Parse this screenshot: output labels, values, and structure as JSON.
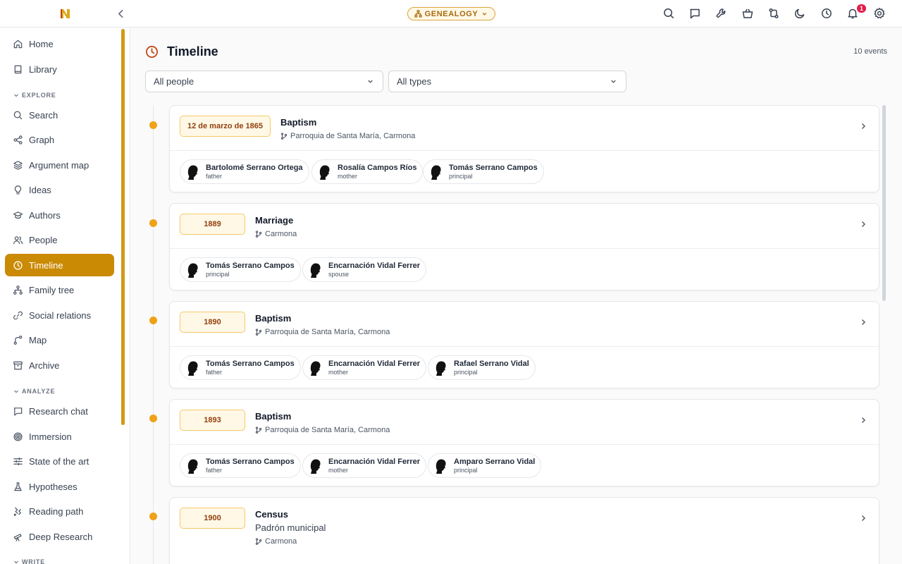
{
  "app": {
    "mode_label": "GENEALOGY",
    "notification_count": "1"
  },
  "sidebar": {
    "items_top": [
      {
        "id": "home",
        "label": "Home",
        "icon": "home-icon"
      },
      {
        "id": "library",
        "label": "Library",
        "icon": "book-icon"
      }
    ],
    "sections": [
      {
        "label": "EXPLORE",
        "items": [
          {
            "id": "search",
            "label": "Search",
            "icon": "search-icon"
          },
          {
            "id": "graph",
            "label": "Graph",
            "icon": "share-icon"
          },
          {
            "id": "argument-map",
            "label": "Argument map",
            "icon": "layers-icon"
          },
          {
            "id": "ideas",
            "label": "Ideas",
            "icon": "lightbulb-icon"
          },
          {
            "id": "authors",
            "label": "Authors",
            "icon": "graduation-cap-icon"
          },
          {
            "id": "people",
            "label": "People",
            "icon": "users-icon"
          },
          {
            "id": "timeline",
            "label": "Timeline",
            "icon": "clock-icon",
            "active": true
          },
          {
            "id": "family-tree",
            "label": "Family tree",
            "icon": "family-tree-icon"
          },
          {
            "id": "social-relations",
            "label": "Social relations",
            "icon": "link-icon"
          },
          {
            "id": "map",
            "label": "Map",
            "icon": "map-route-icon"
          },
          {
            "id": "archive",
            "label": "Archive",
            "icon": "archive-icon"
          }
        ]
      },
      {
        "label": "ANALYZE",
        "items": [
          {
            "id": "research-chat",
            "label": "Research chat",
            "icon": "chat-icon"
          },
          {
            "id": "immersion",
            "label": "Immersion",
            "icon": "target-icon"
          },
          {
            "id": "state-of-the-art",
            "label": "State of the art",
            "icon": "sliders-icon"
          },
          {
            "id": "hypotheses",
            "label": "Hypotheses",
            "icon": "flask-icon"
          },
          {
            "id": "reading-path",
            "label": "Reading path",
            "icon": "footprints-icon"
          },
          {
            "id": "deep-research",
            "label": "Deep Research",
            "icon": "telescope-icon"
          }
        ]
      },
      {
        "label": "WRITE",
        "items": []
      }
    ]
  },
  "main": {
    "title": "Timeline",
    "event_count": "10 events",
    "filters": {
      "people": "All people",
      "types": "All types"
    },
    "events": [
      {
        "date": "12 de marzo de 1865",
        "type": "Baptism",
        "subtitle": "",
        "place": "Parroquia de Santa María, Carmona",
        "people": [
          {
            "name": "Bartolomé Serrano Ortega",
            "role": "father"
          },
          {
            "name": "Rosalía Campos Ríos",
            "role": "mother"
          },
          {
            "name": "Tomás Serrano Campos",
            "role": "principal"
          }
        ]
      },
      {
        "date": "1889",
        "type": "Marriage",
        "subtitle": "",
        "place": "Carmona",
        "people": [
          {
            "name": "Tomás Serrano Campos",
            "role": "principal"
          },
          {
            "name": "Encarnación Vidal Ferrer",
            "role": "spouse"
          }
        ]
      },
      {
        "date": "1890",
        "type": "Baptism",
        "subtitle": "",
        "place": "Parroquia de Santa María, Carmona",
        "people": [
          {
            "name": "Tomás Serrano Campos",
            "role": "father"
          },
          {
            "name": "Encarnación Vidal Ferrer",
            "role": "mother"
          },
          {
            "name": "Rafael Serrano Vidal",
            "role": "principal"
          }
        ]
      },
      {
        "date": "1893",
        "type": "Baptism",
        "subtitle": "",
        "place": "Parroquia de Santa María, Carmona",
        "people": [
          {
            "name": "Tomás Serrano Campos",
            "role": "father"
          },
          {
            "name": "Encarnación Vidal Ferrer",
            "role": "mother"
          },
          {
            "name": "Amparo Serrano Vidal",
            "role": "principal"
          }
        ]
      },
      {
        "date": "1900",
        "type": "Census",
        "subtitle": "Padrón municipal",
        "place": "Carmona",
        "people": []
      }
    ]
  },
  "colors": {
    "accent": "#ca8a04",
    "timeline_dot": "#f0a217",
    "badge": "#e11d48"
  }
}
